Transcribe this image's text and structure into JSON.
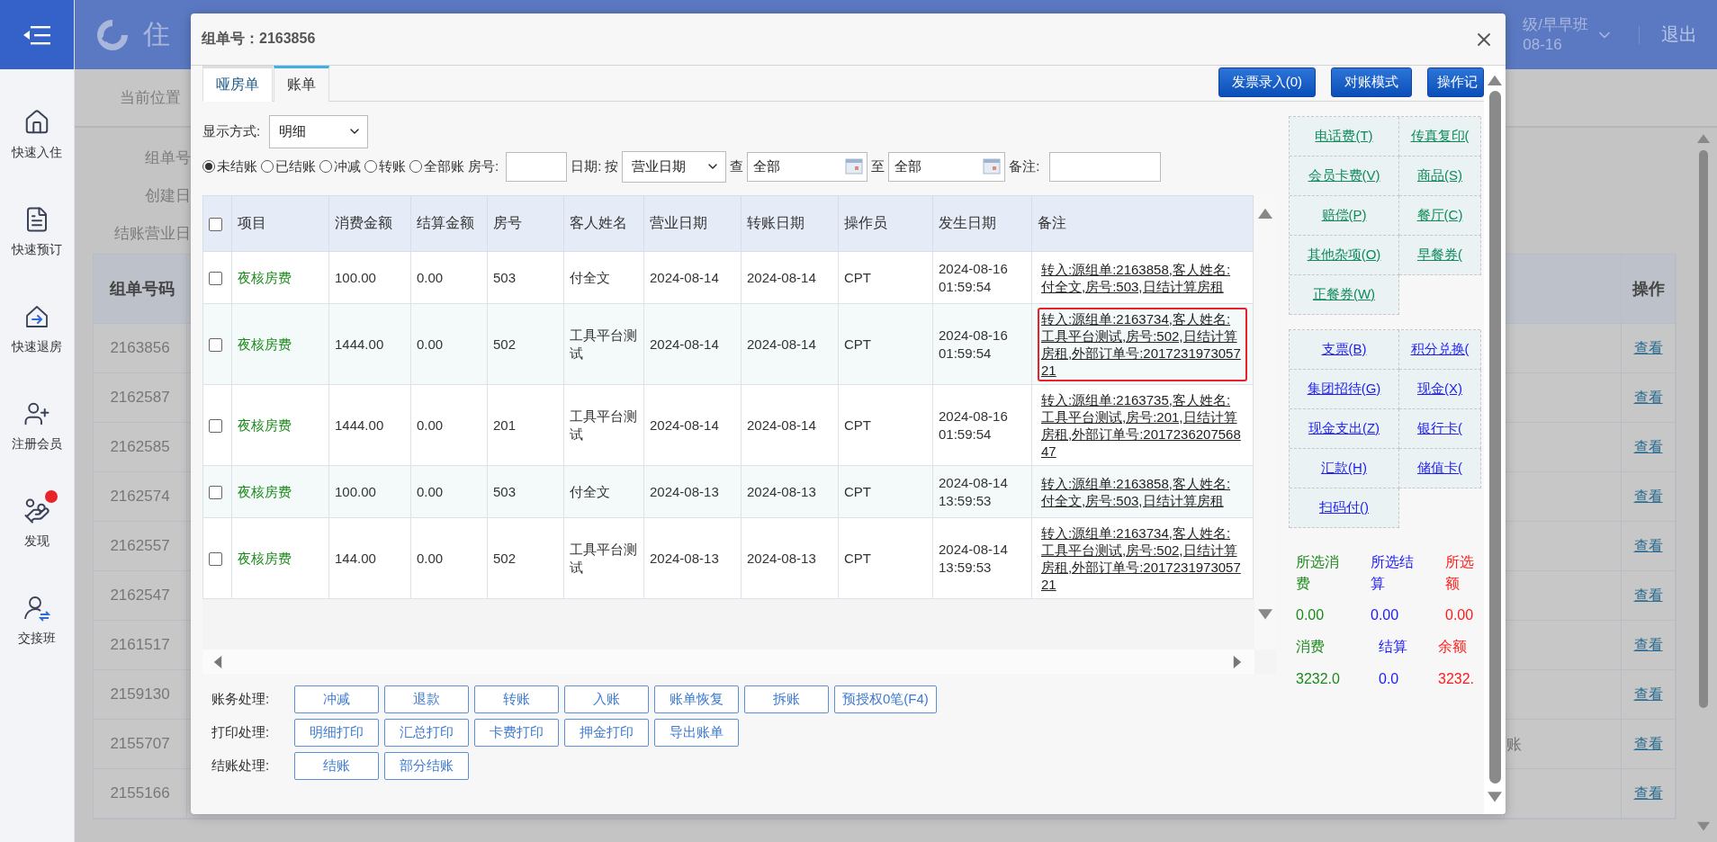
{
  "app_header": {
    "brand": "住",
    "user_info": "级/早早班",
    "date": "08-16",
    "logout": "退出"
  },
  "sidebar": {
    "items": [
      {
        "label": "快速入住",
        "kind": "checkin",
        "badge": false
      },
      {
        "label": "快速预订",
        "kind": "booking",
        "badge": false
      },
      {
        "label": "快速退房",
        "kind": "checkout",
        "badge": false
      },
      {
        "label": "注册会员",
        "kind": "member",
        "badge": false
      },
      {
        "label": "发现",
        "kind": "discover",
        "badge": true
      },
      {
        "label": "交接班",
        "kind": "shift",
        "badge": false
      }
    ]
  },
  "page": {
    "breadcrumb": "当前位置",
    "form_labels": [
      "组单号",
      "创建日",
      "结账营业日"
    ],
    "table": {
      "columns": {
        "column_1": "组单号码",
        "action": "操作"
      },
      "rows": [
        {
          "group_no": "2163856",
          "action": "查看"
        },
        {
          "group_no": "2162587",
          "action": "查看"
        },
        {
          "group_no": "2162585",
          "action": "查看"
        },
        {
          "group_no": "2162574",
          "action": "查看"
        },
        {
          "group_no": "2162557",
          "action": "查看"
        },
        {
          "group_no": "2162547",
          "action": "查看"
        },
        {
          "group_no": "2161517",
          "action": "查看"
        },
        {
          "group_no": "2159130",
          "action": "查看"
        },
        {
          "group_no": "2155707",
          "column_2": "账",
          "action": "查看"
        },
        {
          "group_no": "2155166",
          "action": "查看"
        }
      ]
    }
  },
  "modal": {
    "title": "组单号：2163856",
    "tabs": [
      {
        "label": "哑房单",
        "selected": false
      },
      {
        "label": "账单",
        "selected": true
      }
    ],
    "toolbar": [
      "发票录入(0)",
      "对账模式",
      "操作记"
    ],
    "display_mode": {
      "label": "显示方式:",
      "value": "明细"
    },
    "filters": {
      "radios": [
        {
          "label": "未结账",
          "selected": true
        },
        {
          "label": "已结账",
          "selected": false
        },
        {
          "label": "冲减",
          "selected": false
        },
        {
          "label": "转账",
          "selected": false
        },
        {
          "label": "全部账",
          "selected": false
        }
      ],
      "room_label": "房号:",
      "date_label": "日期:",
      "by_label": "按",
      "date_type": "营业日期",
      "from_label": "查",
      "from": "全部",
      "to_label": "至",
      "to": "全部",
      "remark_label": "备注:"
    },
    "bill_table": {
      "all_checked": false,
      "columns": [
        "项目",
        "消费金额",
        "结算金额",
        "房号",
        "客人姓名",
        "营业日期",
        "转账日期",
        "操作员",
        "发生日期",
        "备注"
      ],
      "rows": [
        {
          "checked": false,
          "item": "夜核房费",
          "consumed": "100.00",
          "settled": "0.00",
          "room": "503",
          "guest": "付全文",
          "business_date": "2024-08-14",
          "transfer_date": "2024-08-14",
          "operator": "CPT",
          "occurred": "2024-08-16 01:59:54",
          "remark": "转入:源组单:2163858,客人姓名:付全文,房号:503,日结计算房租",
          "highlighted": false
        },
        {
          "checked": false,
          "item": "夜核房费",
          "consumed": "1444.00",
          "settled": "0.00",
          "room": "502",
          "guest": "工具平台测试",
          "business_date": "2024-08-14",
          "transfer_date": "2024-08-14",
          "operator": "CPT",
          "occurred": "2024-08-16 01:59:54",
          "remark": "转入:源组单:2163734,客人姓名:工具平台测试,房号:502,日结计算房租,外部订单号:201723197305721",
          "highlighted": true
        },
        {
          "checked": false,
          "item": "夜核房费",
          "consumed": "1444.00",
          "settled": "0.00",
          "room": "201",
          "guest": "工具平台测试",
          "business_date": "2024-08-14",
          "transfer_date": "2024-08-14",
          "operator": "CPT",
          "occurred": "2024-08-16 01:59:54",
          "remark": "转入:源组单:2163735,客人姓名:工具平台测试,房号:201,日结计算房租,外部订单号:201723620756847",
          "highlighted": false
        },
        {
          "checked": false,
          "item": "夜核房费",
          "consumed": "100.00",
          "settled": "0.00",
          "room": "503",
          "guest": "付全文",
          "business_date": "2024-08-13",
          "transfer_date": "2024-08-13",
          "operator": "CPT",
          "occurred": "2024-08-14 13:59:53",
          "remark": "转入:源组单:2163858,客人姓名:付全文,房号:503,日结计算房租",
          "highlighted": false
        },
        {
          "checked": false,
          "item": "夜核房费",
          "consumed": "144.00",
          "settled": "0.00",
          "room": "502",
          "guest": "工具平台测试",
          "business_date": "2024-08-13",
          "transfer_date": "2024-08-13",
          "operator": "CPT",
          "occurred": "2024-08-14 13:59:53",
          "remark": "转入:源组单:2163734,客人姓名:工具平台测试,房号:502,日结计算房租,外部订单号:201723197305721",
          "highlighted": false
        }
      ]
    },
    "actions": [
      {
        "label": "账务处理:",
        "buttons": [
          "冲减",
          "退款",
          "转账",
          "入账",
          "账单恢复",
          "拆账",
          "预授权0笔(F4)"
        ]
      },
      {
        "label": "打印处理:",
        "buttons": [
          "明细打印",
          "汇总打印",
          "卡费打印",
          "押金打印",
          "导出账单"
        ]
      },
      {
        "label": "结账处理:",
        "buttons": [
          "结账",
          "部分结账"
        ]
      }
    ],
    "quick_items": [
      {
        "kind": "charge",
        "items": [
          "电话费(T)",
          "传真复印(",
          "会员卡费(V)",
          "商品(S)",
          "赔偿(P)",
          "餐厅(C)",
          "其他杂项(O)",
          "早餐券(",
          "正餐券(W)"
        ]
      },
      {
        "kind": "payment",
        "items": [
          "支票(B)",
          "积分兑换(",
          "集团招待(G)",
          "现金(X)",
          "现金支出(Z)",
          "银行卡(",
          "汇款(H)",
          "储值卡(",
          "扫码付()"
        ]
      }
    ],
    "summary": {
      "selected": [
        {
          "label_lines": [
            "所选消",
            "费"
          ],
          "value": "0.00",
          "color": "#1a8a1a"
        },
        {
          "label_lines": [
            "所选结",
            "算"
          ],
          "value": "0.00",
          "color": "#1a1aff"
        },
        {
          "label_lines": [
            "所选",
            "额"
          ],
          "value": "0.00",
          "color": "#ff1a1a"
        }
      ],
      "totals": [
        {
          "label": "消费",
          "value": "3232.0",
          "color": "#1a8a1a"
        },
        {
          "label": "结算",
          "value": "0.0",
          "color": "#1a1aff"
        },
        {
          "label": "余额",
          "value": "3232.",
          "color": "#ff1a1a"
        }
      ]
    }
  }
}
